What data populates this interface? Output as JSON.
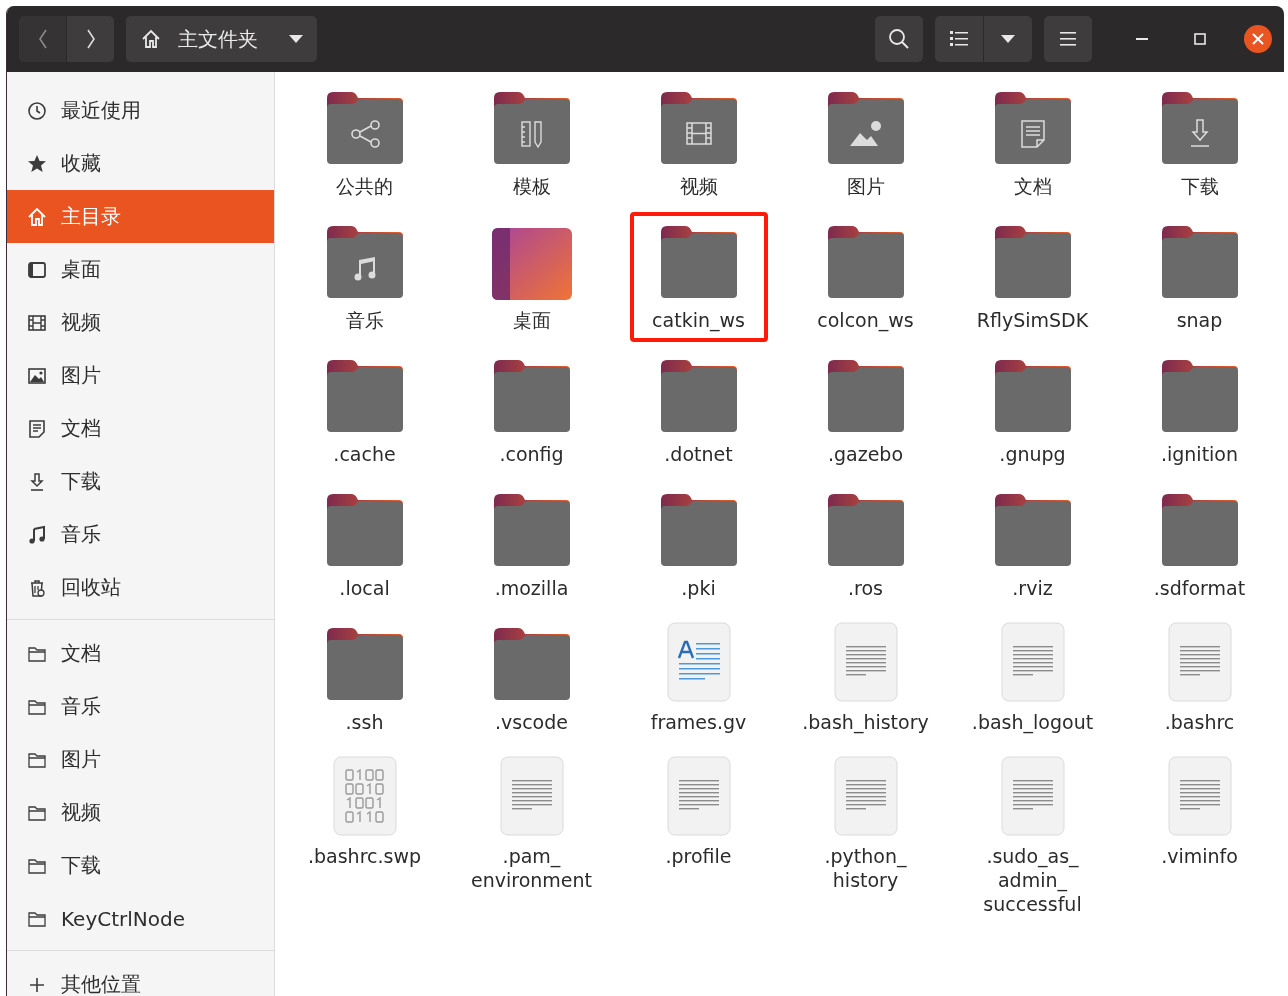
{
  "header": {
    "location": "主文件夹"
  },
  "sidebar": {
    "places": [
      {
        "label": "最近使用",
        "selected": false
      },
      {
        "label": "收藏",
        "selected": false
      },
      {
        "label": "主目录",
        "selected": true
      },
      {
        "label": "桌面",
        "selected": false
      },
      {
        "label": "视频",
        "selected": false
      },
      {
        "label": "图片",
        "selected": false
      },
      {
        "label": "文档",
        "selected": false
      },
      {
        "label": "下载",
        "selected": false
      },
      {
        "label": "音乐",
        "selected": false
      },
      {
        "label": "回收站",
        "selected": false
      }
    ],
    "bookmarks": [
      {
        "label": "文档",
        "selected": false
      },
      {
        "label": "音乐",
        "selected": false
      },
      {
        "label": "图片",
        "selected": false
      },
      {
        "label": "视频",
        "selected": false
      },
      {
        "label": "下载",
        "selected": false
      },
      {
        "label": "KeyCtrlNode",
        "selected": false
      }
    ],
    "other": {
      "label": "其他位置"
    }
  },
  "files": [
    {
      "name": [
        "公共的"
      ],
      "kind": "sharefolder",
      "highlighted": false
    },
    {
      "name": [
        "模板"
      ],
      "kind": "templatefolder",
      "highlighted": false
    },
    {
      "name": [
        "视频"
      ],
      "kind": "videofolder",
      "highlighted": false
    },
    {
      "name": [
        "图片"
      ],
      "kind": "picturefolder",
      "highlighted": false
    },
    {
      "name": [
        "文档"
      ],
      "kind": "documentfolder",
      "highlighted": false
    },
    {
      "name": [
        "下载"
      ],
      "kind": "downloadfolder",
      "highlighted": false
    },
    {
      "name": [
        "音乐"
      ],
      "kind": "musicfolder",
      "highlighted": false
    },
    {
      "name": [
        "桌面"
      ],
      "kind": "desktop",
      "highlighted": false
    },
    {
      "name": [
        "catkin_ws"
      ],
      "kind": "folder",
      "highlighted": true
    },
    {
      "name": [
        "colcon_ws"
      ],
      "kind": "folder",
      "highlighted": false
    },
    {
      "name": [
        "RflySimSDK"
      ],
      "kind": "folder",
      "highlighted": false
    },
    {
      "name": [
        "snap"
      ],
      "kind": "folder",
      "highlighted": false
    },
    {
      "name": [
        ".cache"
      ],
      "kind": "folder",
      "highlighted": false
    },
    {
      "name": [
        ".config"
      ],
      "kind": "folder",
      "highlighted": false
    },
    {
      "name": [
        ".dotnet"
      ],
      "kind": "folder",
      "highlighted": false
    },
    {
      "name": [
        ".gazebo"
      ],
      "kind": "folder",
      "highlighted": false
    },
    {
      "name": [
        ".gnupg"
      ],
      "kind": "folder",
      "highlighted": false
    },
    {
      "name": [
        ".ignition"
      ],
      "kind": "folder",
      "highlighted": false
    },
    {
      "name": [
        ".local"
      ],
      "kind": "folder",
      "highlighted": false
    },
    {
      "name": [
        ".mozilla"
      ],
      "kind": "folder",
      "highlighted": false
    },
    {
      "name": [
        ".pki"
      ],
      "kind": "folder",
      "highlighted": false
    },
    {
      "name": [
        ".ros"
      ],
      "kind": "folder",
      "highlighted": false
    },
    {
      "name": [
        ".rviz"
      ],
      "kind": "folder",
      "highlighted": false
    },
    {
      "name": [
        ".sdformat"
      ],
      "kind": "folder",
      "highlighted": false
    },
    {
      "name": [
        ".ssh"
      ],
      "kind": "folder",
      "highlighted": false
    },
    {
      "name": [
        ".vscode"
      ],
      "kind": "folder",
      "highlighted": false
    },
    {
      "name": [
        "frames.gv"
      ],
      "kind": "richtext",
      "highlighted": false
    },
    {
      "name": [
        ".bash_history"
      ],
      "kind": "text",
      "highlighted": false
    },
    {
      "name": [
        ".bash_logout"
      ],
      "kind": "text",
      "highlighted": false
    },
    {
      "name": [
        ".bashrc"
      ],
      "kind": "text",
      "highlighted": false
    },
    {
      "name": [
        ".bashrc.swp"
      ],
      "kind": "binary",
      "highlighted": false
    },
    {
      "name": [
        ".pam_",
        "environment"
      ],
      "kind": "text",
      "highlighted": false
    },
    {
      "name": [
        ".profile"
      ],
      "kind": "text",
      "highlighted": false
    },
    {
      "name": [
        ".python_",
        "history"
      ],
      "kind": "text",
      "highlighted": false
    },
    {
      "name": [
        ".sudo_as_",
        "admin_",
        "successful"
      ],
      "kind": "text",
      "highlighted": false
    },
    {
      "name": [
        ".viminfo"
      ],
      "kind": "text",
      "highlighted": false
    }
  ]
}
